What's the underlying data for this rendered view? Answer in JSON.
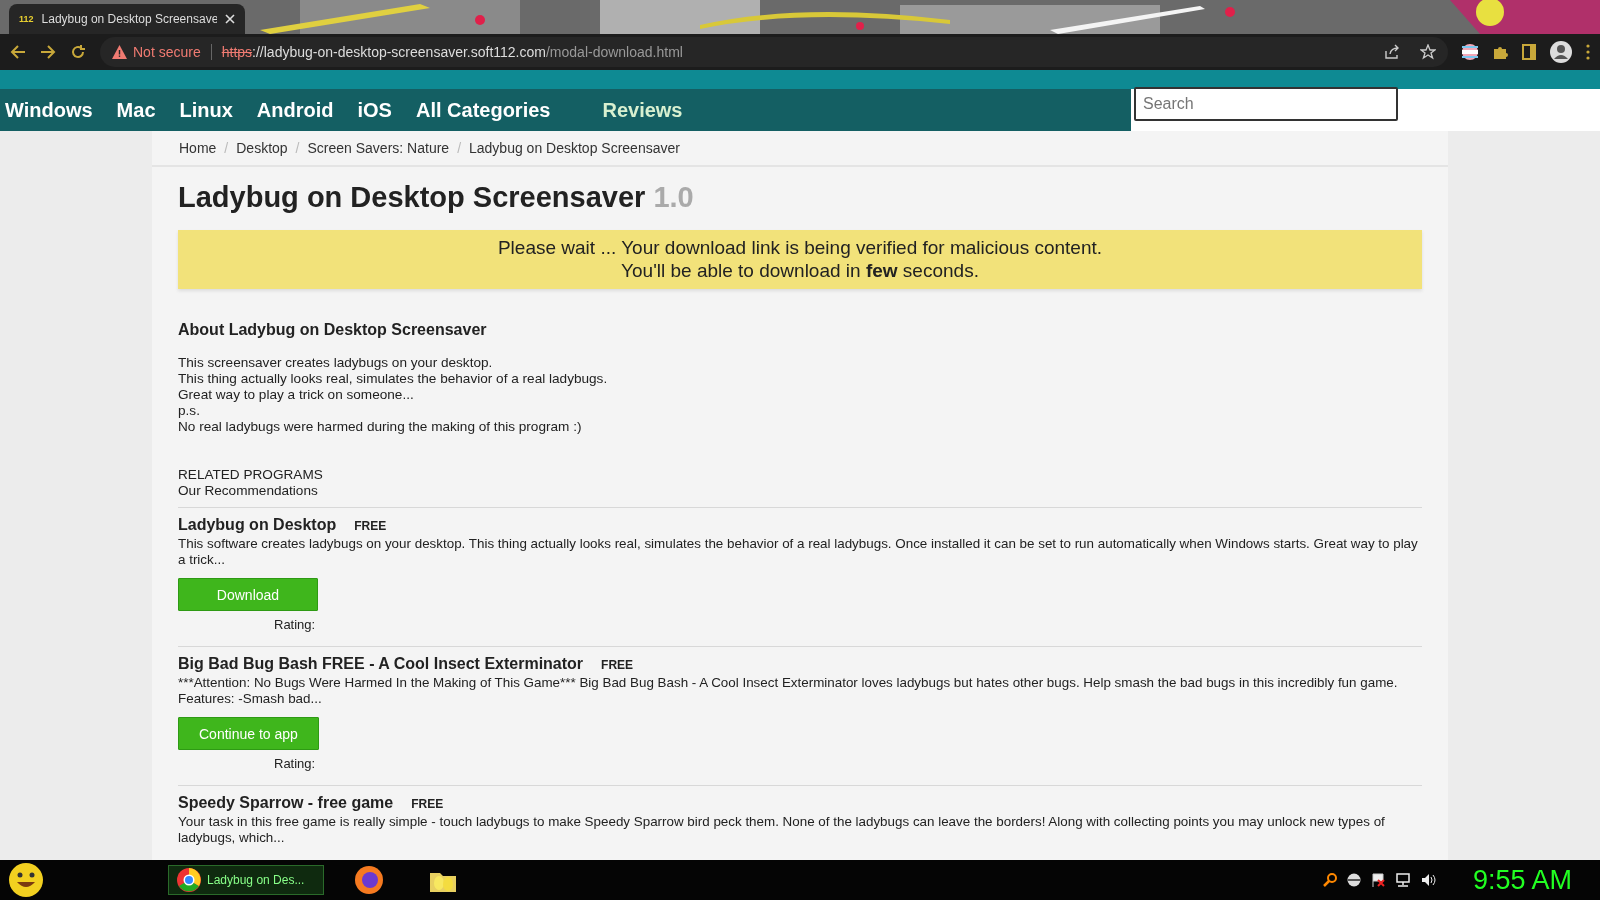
{
  "browser": {
    "tab": {
      "title": "Ladybug on Desktop Screensave",
      "favicon": "112"
    },
    "security": "Not secure",
    "url_scheme": "https",
    "url_host": "://ladybug-on-desktop-screensaver.soft112.com",
    "url_path": "/modal-download.html"
  },
  "nav": {
    "items": [
      "Windows",
      "Mac",
      "Linux",
      "Android",
      "iOS",
      "All Categories",
      "Reviews"
    ],
    "search_placeholder": "Search"
  },
  "breadcrumb": [
    "Home",
    "Desktop",
    "Screen Savers: Nature",
    "Ladybug on Desktop Screensaver"
  ],
  "breadcrumb_separator": "/",
  "title": "Ladybug on Desktop Screensaver",
  "version": "1.0",
  "notice": [
    "Please wait ... Your download link is being verified for malicious content.",
    "You'll be able to download in **few** seconds."
  ],
  "about": {
    "heading": "About Ladybug on Desktop Screensaver",
    "lines": [
      "This screensaver creates ladybugs on your desktop.",
      "This thing actually looks real, simulates the behavior of a real ladybugs.",
      "Great way to play a trick on someone...",
      "p.s.",
      "No real ladybugs were harmed during the making of this program :)"
    ]
  },
  "related": {
    "heading": "RELATED PROGRAMS",
    "subheading": "Our Recommendations"
  },
  "programs": [
    {
      "name": "Ladybug on Desktop",
      "badge": "FREE",
      "description": "This software creates ladybugs on your desktop. This thing actually looks real, simulates the behavior of a real ladybugs. Once installed it can be set to run automatically when Windows starts. Great way to play a trick...",
      "button": "Download",
      "rating_label": "Rating:"
    },
    {
      "name": "Big Bad Bug Bash FREE - A Cool Insect Exterminator",
      "badge": "FREE",
      "description": "***Attention: No Bugs Were Harmed In the Making of This Game*** Big Bad Bug Bash - A Cool Insect Exterminator loves ladybugs but hates other bugs. Help smash the bad bugs in this incredibly fun game. Features: -Smash bad...",
      "button": "Continue to app",
      "rating_label": "Rating:"
    },
    {
      "name": "Speedy Sparrow - free game",
      "badge": "FREE",
      "description": "Your task in this free game is really simple - touch ladybugs to make Speedy Sparrow bird peck them. None of the ladybugs can leave the borders! Along with collecting points you may unlock new types of ladybugs, which..."
    }
  ],
  "taskbar": {
    "task": "Ladybug on Des...",
    "clock": "9:55 AM"
  }
}
